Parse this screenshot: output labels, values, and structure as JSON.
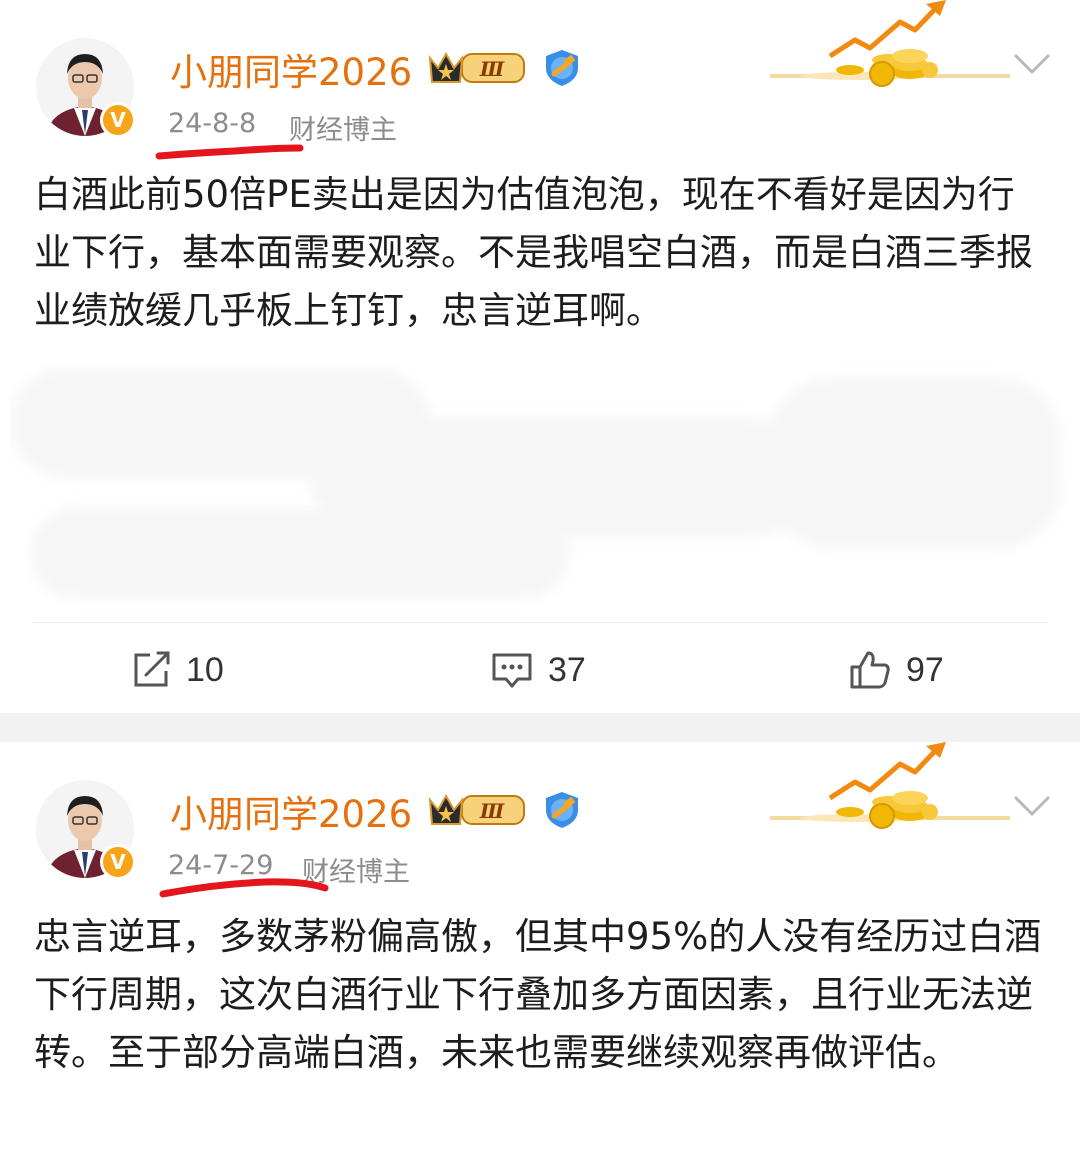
{
  "posts": [
    {
      "username": "小朋同学2026",
      "level_badge": "Ⅲ",
      "verified_badge": "V",
      "date": "24-8-8",
      "role": "财经博主",
      "text": "白酒此前50倍PE卖出是因为估值泡泡，现在不看好是因为行业下行，基本面需要观察。不是我唱空白酒，而是白酒三季报业绩放缓几乎板上钉钉，忠言逆耳啊。",
      "actions": {
        "repost_icon": "share-icon",
        "repost_count": "10",
        "comment_icon": "comment-icon",
        "comment_count": "37",
        "like_icon": "thumbs-up-icon",
        "like_count": "97"
      }
    },
    {
      "username": "小朋同学2026",
      "level_badge": "Ⅲ",
      "verified_badge": "V",
      "date": "24-7-29",
      "role": "财经博主",
      "text": "忠言逆耳，多数茅粉偏高傲，但其中95%的人没有经历过白酒下行周期，这次白酒行业下行叠加多方面因素，且行业无法逆转。至于部分高端白酒，未来也需要继续观察再做评估。"
    }
  ],
  "colors": {
    "username": "#e7700e",
    "meta_gray": "#8c8c8c",
    "red_underline": "#e3161c",
    "verified_badge": "#f7a418",
    "separator_bg": "#f2f2f2"
  }
}
